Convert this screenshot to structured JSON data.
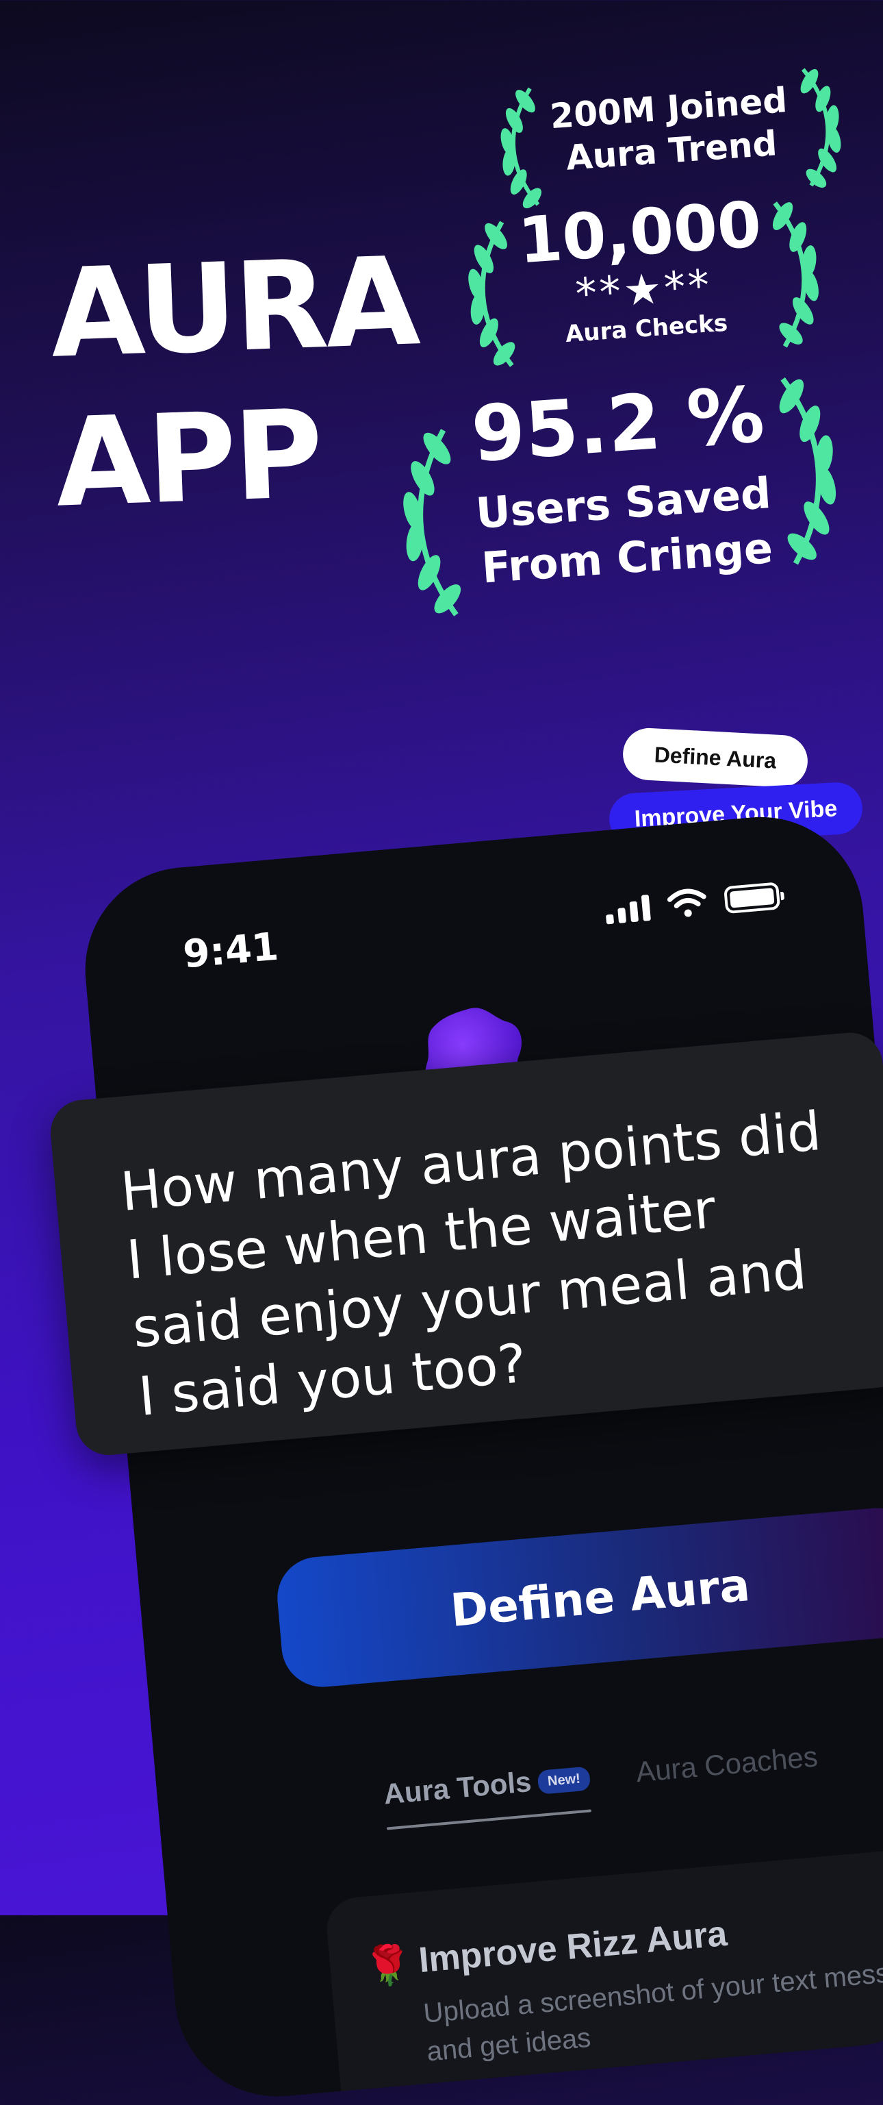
{
  "headline": {
    "line1": "AURA",
    "line2": "APP"
  },
  "awards": [
    {
      "line1": "200M Joined",
      "line2": "Aura Trend"
    },
    {
      "big": "10,000",
      "stars": "**★**",
      "small": "Aura Checks"
    },
    {
      "big": "95.2 %",
      "line1": "Users Saved",
      "line2": "From Cringe"
    }
  ],
  "pills": {
    "define": "Define Aura",
    "improve": "Improve Your Vibe"
  },
  "phone": {
    "time": "9:41",
    "question": "How many aura points did I lose when the waiter said enjoy your meal and I said you too?",
    "primary_button": "Define Aura",
    "tabs": {
      "tools": "Aura Tools",
      "tools_badge": "New!",
      "coaches": "Aura Coaches"
    },
    "card": {
      "icon": "🌹",
      "title": "Improve Rizz Aura",
      "description": "Upload a screenshot of your text messages and get ideas"
    }
  },
  "colors": {
    "laurel": "#4ee6a0",
    "accent_blue": "#2f20f0",
    "background_top": "#0d0a1f",
    "background_bottom": "#4a16d8"
  }
}
